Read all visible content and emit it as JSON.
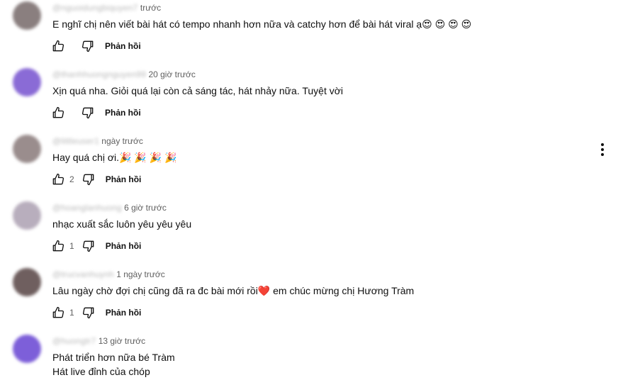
{
  "reply_label": "Phản hồi",
  "colors": {
    "text": "#0f0f0f",
    "meta": "#606060"
  },
  "comments": [
    {
      "author": "@nguoidungbiquyen7",
      "time": "trước",
      "text": [
        "E nghĩ chị nên viết bài hát có tempo nhanh hơn nữa và catchy hơn để bài hát viral ạ😍 😍 😍 😍"
      ],
      "likes": "",
      "avatar_color": "#8a7f7f"
    },
    {
      "author": "@thanhhuongnguyen99",
      "time": "20 giờ trước",
      "text": [
        "Xịn quá nha. Giỏi quá lại còn cả sáng tác, hát nhảy nữa. Tuyệt vời"
      ],
      "likes": "",
      "avatar_color": "#8a6bd6"
    },
    {
      "author": "@littleuser1",
      "time": "ngày trước",
      "text": [
        "Hay quá chị ơi.🎉 🎉 🎉 🎉"
      ],
      "likes": "2",
      "avatar_color": "#9a8d8d"
    },
    {
      "author": "@hoanglanhuong",
      "time": "6 giờ trước",
      "text": [
        "nhạc xuất sắc luôn yêu yêu yêu"
      ],
      "likes": "1",
      "avatar_color": "#b8aebd"
    },
    {
      "author": "@trucvanhuynh",
      "time": "1 ngày trước",
      "text": [
        "Lâu ngày chờ đợi chị cũng đã ra đc bài mới rồi❤️  em chúc mừng chị Hương Tràm"
      ],
      "likes": "1",
      "avatar_color": "#6f5f5f"
    },
    {
      "author": "@huongtr7",
      "time": "13 giờ trước",
      "text": [
        "Phát triển hơn nữa bé Tràm",
        "Hát live đỉnh của chóp"
      ],
      "likes": "",
      "avatar_color": "#7d5fd9"
    }
  ]
}
